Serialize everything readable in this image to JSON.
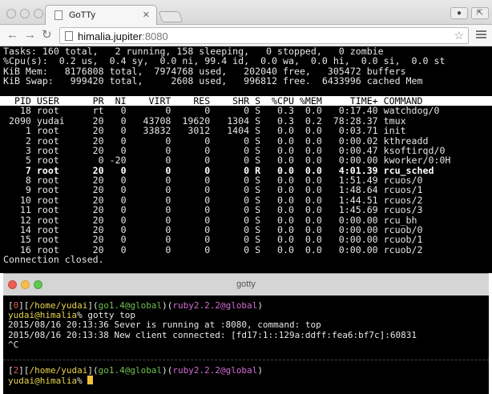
{
  "browser": {
    "tab_title": "GoTTy",
    "url_host": "himalia.jupiter",
    "url_port": ":8080"
  },
  "top": {
    "tasks": "Tasks: 160 total,   2 running, 158 sleeping,   0 stopped,   0 zombie",
    "cpu": "%Cpu(s):  0.2 us,  0.4 sy,  0.0 ni, 99.4 id,  0.0 wa,  0.0 hi,  0.0 si,  0.0 st",
    "mem": "KiB Mem:   8176808 total,  7974768 used,   202040 free,   305472 buffers",
    "swap": "KiB Swap:   999420 total,     2608 used,   996812 free.  6433996 cached Mem",
    "header": "  PID USER      PR  NI    VIRT    RES    SHR S  %CPU %MEM     TIME+ COMMAND        ",
    "processes": [
      "   18 root      rt   0       0      0      0 S   0.3  0.0   0:17.40 watchdog/0",
      " 2090 yudai     20   0   43708  19620   1304 S   0.3  0.2  78:28.37 tmux",
      "    1 root      20   0   33832   3012   1404 S   0.0  0.0   0:03.71 init",
      "    2 root      20   0       0      0      0 S   0.0  0.0   0:00.02 kthreadd",
      "    3 root      20   0       0      0      0 S   0.0  0.0   0:00.47 ksoftirqd/0",
      "    5 root       0 -20       0      0      0 S   0.0  0.0   0:00.00 kworker/0:0H",
      "    7 root      20   0       0      0      0 R   0.0  0.0   4:01.39 rcu_sched",
      "    8 root      20   0       0      0      0 S   0.0  0.0   1:51.49 rcuos/0",
      "    9 root      20   0       0      0      0 S   0.0  0.0   1:48.64 rcuos/1",
      "   10 root      20   0       0      0      0 S   0.0  0.0   1:44.51 rcuos/2",
      "   11 root      20   0       0      0      0 S   0.0  0.0   1:45.69 rcuos/3",
      "   12 root      20   0       0      0      0 S   0.0  0.0   0:00.00 rcu_bh",
      "   14 root      20   0       0      0      0 S   0.0  0.0   0:00.00 rcuob/0",
      "   15 root      20   0       0      0      0 S   0.0  0.0   0:00.00 rcuob/1",
      "   16 root      20   0       0      0      0 S   0.0  0.0   0:00.00 rcuob/2"
    ],
    "highlight_index": 6,
    "closed": "Connection closed."
  },
  "native": {
    "title": "gotty",
    "pane1": {
      "win_index": "0",
      "path": "/home/yudai",
      "go": "go1.4@global",
      "ruby": "ruby2.2.2@global",
      "user_host": "yudai@himalia",
      "prompt_char": "%",
      "command": " gotty top",
      "log1": "2015/08/16 20:13:36 Sever is running at :8080, command: top",
      "log2": "2015/08/16 20:13:38 New client connected: [fd17:1::129a:ddff:fea6:bf7c]:60831",
      "interrupt": "^C"
    },
    "pane2": {
      "win_index": "2",
      "path": "/home/yudai",
      "go": "go1.4@global",
      "ruby": "ruby2.2.2@global",
      "user_host": "yudai@himalia",
      "prompt_char": "%"
    }
  }
}
